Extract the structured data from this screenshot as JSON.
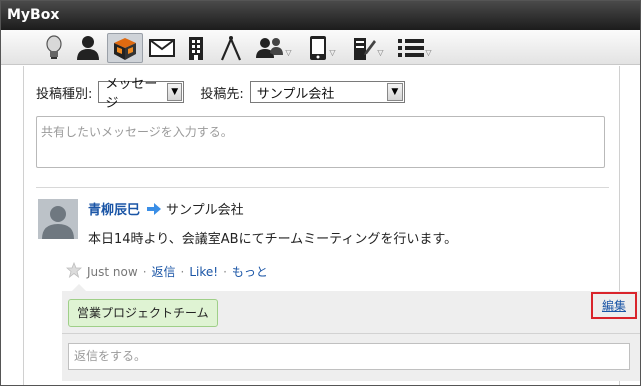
{
  "window": {
    "title": "MyBox"
  },
  "toolbar": {
    "icons": [
      {
        "name": "lightbulb-icon"
      },
      {
        "name": "person-icon"
      },
      {
        "name": "mybox-icon",
        "active": true
      },
      {
        "name": "mail-icon"
      },
      {
        "name": "building-icon"
      },
      {
        "name": "compass-icon"
      },
      {
        "name": "group-icon",
        "dropdown": true
      },
      {
        "name": "phone-icon",
        "dropdown": true
      },
      {
        "name": "edit-doc-icon",
        "dropdown": true
      },
      {
        "name": "list-icon",
        "dropdown": true
      }
    ],
    "active_color": "#cfd3d8"
  },
  "compose": {
    "type_label": "投稿種別:",
    "type_value": "メッセージ",
    "dest_label": "投稿先:",
    "dest_value": "サンプル会社",
    "message_placeholder": "共有したいメッセージを入力する。"
  },
  "post": {
    "author": "青柳辰巳",
    "target": "サンプル会社",
    "body": "本日14時より、会議室ABにてチームミーティングを行います。",
    "time": "Just now",
    "actions": {
      "reply": "返信",
      "like": "Like!",
      "more": "もっと"
    },
    "tag": "営業プロジェクトチーム",
    "edit_label": "編集",
    "reply_placeholder": "返信をする。"
  },
  "colors": {
    "link": "#1a55a6",
    "tag_bg": "#dff3d3",
    "highlight": "#d9242b"
  }
}
